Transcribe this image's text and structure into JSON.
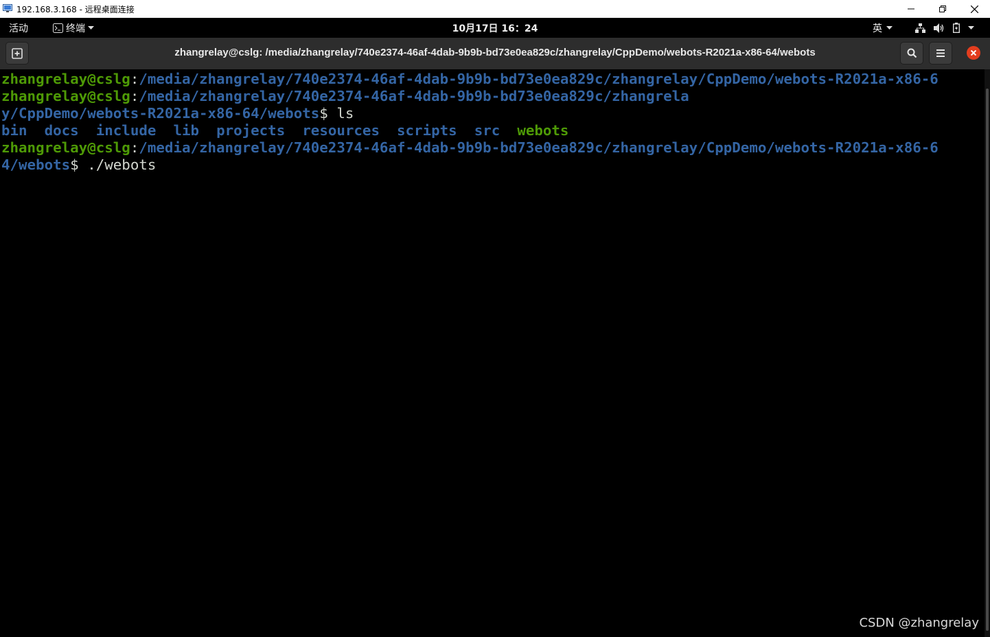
{
  "rdp_window": {
    "title": "192.168.3.168 - 远程桌面连接",
    "icon": "remote-desktop-icon",
    "controls": [
      "minimize-icon",
      "restore-icon",
      "close-icon"
    ]
  },
  "gnome_top_bar": {
    "activities": "活动",
    "app_menu": "终端",
    "clock": "10月17日  16：24",
    "input_method": "英",
    "status_icons": [
      "network-icon",
      "volume-icon",
      "battery-icon"
    ]
  },
  "terminal": {
    "title": "zhangrelay@cslg: /media/zhangrelay/740e2374-46af-4dab-9b9b-bd73e0ea829c/zhangrelay/CppDemo/webots-R2021a-x86-64/webots",
    "lines": [
      {
        "user": "zhangrelay@cslg",
        "sep": ":",
        "path": "/media/zhangrelay/740e2374-46af-4dab-9b9b-bd73e0ea829c/zhangrelay/CppDemo/webots-R2021a-x86-6"
      },
      {
        "user": "zhangrelay@cslg",
        "sep": ":",
        "path": "/media/zhangrelay/740e2374-46af-4dab-9b9b-bd73e0ea829c/zhangrela"
      },
      {
        "path": "y/CppDemo/webots-R2021a-x86-64/webots",
        "prompt": "$ ",
        "cmd": "ls"
      },
      {
        "ls_output": [
          "bin",
          "docs",
          "include",
          "lib",
          "projects",
          "resources",
          "scripts",
          "src",
          "webots"
        ]
      },
      {
        "user": "zhangrelay@cslg",
        "sep": ":",
        "path": "/media/zhangrelay/740e2374-46af-4dab-9b9b-bd73e0ea829c/zhangrelay/CppDemo/webots-R2021a-x86-6"
      },
      {
        "path": "4/webots",
        "prompt": "$ ",
        "cmd": "./webots"
      }
    ]
  },
  "watermark": "CSDN @zhangrelay",
  "colors": {
    "user_green": "#4e9a06",
    "path_blue": "#3465a4",
    "text_default": "#d3d7cf",
    "close_red": "#e33d1e"
  }
}
